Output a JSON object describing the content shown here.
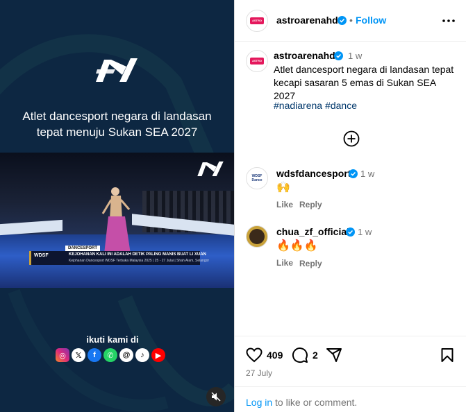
{
  "media": {
    "headline_line1": "Atlet dancesport negara di landasan",
    "headline_line2": "tepat menuju Sukan SEA 2027",
    "lower_third_tag": "DANCESPORT",
    "lower_third_brand": "WDSF",
    "lower_third_line1": "KEJOHANAN KALI INI ADALAH DETIK PALING MANIS BUAT LI XUAN",
    "lower_third_line2": "Kejohanan Dancesport WDSF Terbuka Malaysia 2025 | 25 - 27 Julai | Shah Alam, Selangor",
    "follow_us": "ikuti kami di",
    "socials": [
      "instagram-icon",
      "x-icon",
      "facebook-icon",
      "whatsapp-icon",
      "threads-icon",
      "tiktok-icon",
      "youtube-icon"
    ],
    "colors": {
      "background": "#0d2742",
      "swoosh": "#1d4a52"
    }
  },
  "post": {
    "author": "astroarenahd",
    "follow_label": "Follow",
    "separator": "•",
    "caption_author": "astroarenahd",
    "caption_time": "1 w",
    "caption": "Atlet dancesport negara di landasan tepat kecapi sasaran 5 emas di Sukan SEA 2027",
    "hashtags": [
      "#nadiarena",
      "#dance"
    ],
    "comments": [
      {
        "user": "wdsfdancesport",
        "time": "1 w",
        "text": "🙌",
        "like": "Like",
        "reply": "Reply"
      },
      {
        "user": "chua_zf_official",
        "time": "1 w",
        "text": "🔥🔥🔥",
        "like": "Like",
        "reply": "Reply"
      }
    ],
    "likes": "409",
    "comment_count": "2",
    "date": "27 July",
    "login_link": "Log in",
    "login_suffix": " to like or comment.",
    "colors": {
      "link": "#0095f6",
      "hashtag": "#00376b",
      "muted": "#737373",
      "verified": "#0095f6"
    }
  }
}
